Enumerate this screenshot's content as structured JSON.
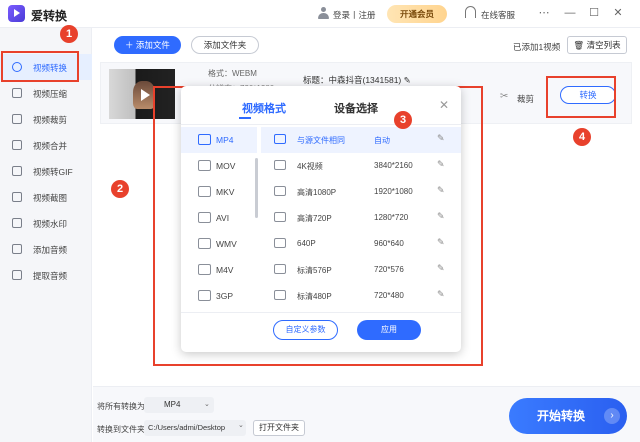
{
  "app": {
    "name": "爱转换"
  },
  "header": {
    "login_label": "登录丨注册",
    "vip_label": "开通会员",
    "service_label": "在线客服",
    "menu_icon": "more-icon",
    "minimize_icon": "minimize-icon",
    "maximize_icon": "maximize-icon",
    "close_icon": "close-icon"
  },
  "sidebar": {
    "items": [
      {
        "label": "视频转换",
        "icon": "convert-icon",
        "active": true
      },
      {
        "label": "视频压缩",
        "icon": "compress-icon"
      },
      {
        "label": "视频裁剪",
        "icon": "scissors-icon"
      },
      {
        "label": "视频合并",
        "icon": "merge-icon"
      },
      {
        "label": "视频转GIF",
        "icon": "gif-icon"
      },
      {
        "label": "视频截图",
        "icon": "screenshot-icon"
      },
      {
        "label": "视频水印",
        "icon": "watermark-icon"
      },
      {
        "label": "添加音频",
        "icon": "add-audio-icon"
      },
      {
        "label": "提取音频",
        "icon": "extract-audio-icon"
      }
    ]
  },
  "toolbar": {
    "add_file": "添加文件",
    "add_folder": "添加文件夹",
    "added_count": "已添加1视频",
    "clear_list": "清空列表"
  },
  "file": {
    "format": "格式：WEBM",
    "resolution": "分辨率：720*1280",
    "title": "标题：中森抖音(1341581)",
    "cut_label": "裁剪",
    "convert_label": "转换"
  },
  "badges": [
    "1",
    "2",
    "3",
    "4"
  ],
  "popup": {
    "tabs": [
      "视频格式",
      "设备选择"
    ],
    "formats": [
      "MP4",
      "MOV",
      "MKV",
      "AVI",
      "WMV",
      "M4V",
      "3GP"
    ],
    "resolutions": [
      {
        "name": "与源文件相同",
        "value": "自动"
      },
      {
        "name": "4K视频",
        "value": "3840*2160"
      },
      {
        "name": "高清1080P",
        "value": "1920*1080"
      },
      {
        "name": "高清720P",
        "value": "1280*720"
      },
      {
        "name": "640P",
        "value": "960*640"
      },
      {
        "name": "标清576P",
        "value": "720*576"
      },
      {
        "name": "标清480P",
        "value": "720*480"
      }
    ],
    "custom_params": "自定义参数",
    "apply": "应用"
  },
  "bottom": {
    "convert_all_label": "将所有转换为:",
    "convert_all_value": "MP4",
    "output_label": "转换到文件夹:",
    "output_path": "C:/Users/admi/Desktop",
    "open_folder": "打开文件夹",
    "start": "开始转换"
  },
  "colors": {
    "accent": "#2f6bff",
    "annotation": "#e8412c",
    "vip": "#ffd48f"
  }
}
